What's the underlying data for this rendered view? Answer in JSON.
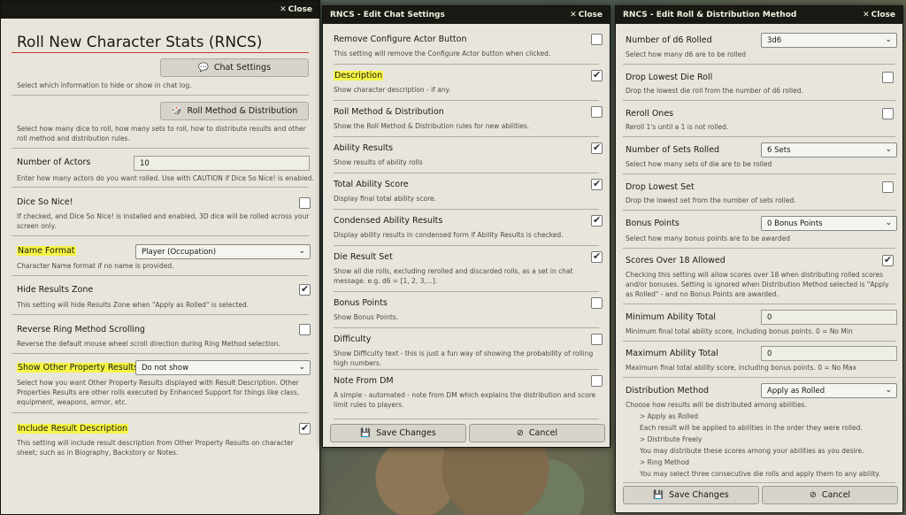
{
  "w1": {
    "close": "Close",
    "title": "Roll New Character Stats (RNCS)",
    "chat_btn": "Chat Settings",
    "chat_hint": "Select which information to hide or show in chat log.",
    "roll_btn": "Roll Method & Distribution",
    "roll_hint": "Select how many dice to roll, how many sets to roll, how to distribute results and other roll method and distribution rules.",
    "actors_label": "Number of Actors",
    "actors_value": "10",
    "actors_hint": "Enter how many actors do you want rolled. Use with CAUTION if Dice So Nice! is enabled.",
    "dsn_label": "Dice So Nice!",
    "dsn_hint": "If checked, and Dice So Nice! is installed and enabled, 3D dice will be rolled across your screen only.",
    "name_label": "Name Format",
    "name_value": "Player (Occupation)",
    "name_hint": "Character Name format if no name is provided.",
    "hide_label": "Hide Results Zone",
    "hide_hint": "This setting will hide Results Zone when \"Apply as Rolled\" is selected.",
    "rev_label": "Reverse Ring Method Scrolling",
    "rev_hint": "Reverse the default mouse wheel scroll direction during Ring Method selection.",
    "other_label": "Show Other Property Results",
    "other_value": "Do not show",
    "other_hint": "Select how you want Other Property Results displayed with Result Description. Other Properties Results are other rolls executed by Enhanced Support for things like class, equipment, weapons, armor, etc.",
    "incl_label": "Include Result Description",
    "incl_hint": "This setting will include result description from Other Property Results on character sheet; such as in Biography, Backstory or Notes."
  },
  "w2": {
    "title": "RNCS - Edit Chat Settings",
    "close": "Close",
    "items": [
      {
        "label": "Remove Configure Actor Button",
        "hint": "This setting will remove the Configure Actor button when clicked."
      },
      {
        "label": "Description",
        "hint": "Show character description - if any."
      },
      {
        "label": "Roll Method & Distribution",
        "hint": "Show the Roll Method & Distribution rules for new abilities."
      },
      {
        "label": "Ability Results",
        "hint": "Show results of ability rolls"
      },
      {
        "label": "Total Ability Score",
        "hint": "Display final total ability score."
      },
      {
        "label": "Condensed Ability Results",
        "hint": "Display ability results in condensed form if Ability Results is checked."
      },
      {
        "label": "Die Result Set",
        "hint": "Show all die rolls, excluding rerolled and discarded rolls, as a set in chat message. e.g. d6 = [1, 2, 3,...]."
      },
      {
        "label": "Bonus Points",
        "hint": "Show Bonus Points."
      },
      {
        "label": "Difficulty",
        "hint": "Show Difficulty text - this is just a fun way of showing the probability of rolling high numbers."
      },
      {
        "label": "Note From DM",
        "hint": "A simple - automated - note from DM which explains the distribution and score limit rules to players."
      }
    ],
    "save": "Save Changes",
    "cancel": "Cancel"
  },
  "w3": {
    "title": "RNCS - Edit Roll & Distribution Method",
    "close": "Close",
    "d6_label": "Number of d6 Rolled",
    "d6_value": "3d6",
    "d6_hint": "Select how many d6 are to be rolled",
    "drop_die_label": "Drop Lowest Die Roll",
    "drop_die_hint": "Drop the lowest die roll from the number of d6 rolled.",
    "reroll_label": "Reroll Ones",
    "reroll_hint": "Reroll 1's until a 1 is not rolled.",
    "sets_label": "Number of Sets Rolled",
    "sets_value": "6 Sets",
    "sets_hint": "Select how many sets of die are to be rolled",
    "drop_set_label": "Drop Lowest Set",
    "drop_set_hint": "Drop the lowest set from the number of sets rolled.",
    "bonus_label": "Bonus Points",
    "bonus_value": "0 Bonus Points",
    "bonus_hint": "Select how many bonus points are to be awarded",
    "over18_label": "Scores Over 18 Allowed",
    "over18_hint": "Checking this setting will allow scores over 18 when distributing rolled scores and/or bonuses. Setting is ignored when Distribution Method selected is \"Apply as Rolled\" - and no Bonus Points are awarded.",
    "min_label": "Minimum Ability Total",
    "min_value": "0",
    "min_hint": "Minimum final total ability score, including bonus points. 0 = No Min",
    "max_label": "Maximum Ability Total",
    "max_value": "0",
    "max_hint": "Maximum final total ability score, including bonus points. 0 = No Max",
    "dist_label": "Distribution Method",
    "dist_value": "Apply as Rolled",
    "dist_hint": "Choose how results will be distributed among abilities.",
    "dist_l1": "> Apply as Rolled",
    "dist_l2": "Each result will be applied to abilities in the order they were rolled.",
    "dist_l3": "> Distribute Freely",
    "dist_l4": "You may distribute these scores among your abilities as you desire.",
    "dist_l5": "> Ring Method",
    "dist_l6": "You may select three consecutive die rolls and apply them to any ability.",
    "save": "Save Changes",
    "cancel": "Cancel"
  }
}
